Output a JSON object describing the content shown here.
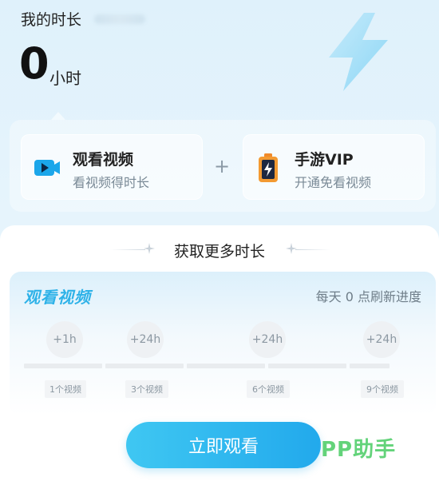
{
  "header": {
    "title": "我的时长",
    "hours_value": "0",
    "hours_unit": "小时"
  },
  "options": [
    {
      "title": "观看视频",
      "subtitle": "看视频得时长",
      "icon": "video-camera-icon"
    },
    {
      "title": "手游VIP",
      "subtitle": "开通免看视频",
      "icon": "battery-bolt-icon"
    }
  ],
  "plus_symbol": "+",
  "section": {
    "title": "获取更多时长"
  },
  "watch_card": {
    "label": "观看视频",
    "refresh_note": "每天 0 点刷新进度",
    "milestones": [
      {
        "reward": "+1h",
        "requirement": "1个视频"
      },
      {
        "reward": "+24h",
        "requirement": "3个视频"
      },
      {
        "reward": "+24h",
        "requirement": "6个视频"
      },
      {
        "reward": "+24h",
        "requirement": "9个视频"
      }
    ],
    "progress": 0
  },
  "cta": {
    "label": "立即观看"
  },
  "watermark": "PP助手",
  "colors": {
    "accent": "#22a9ec",
    "accent_light": "#3fc7f2",
    "label_blue": "#2eb2e8",
    "watermark_green": "#63d37a"
  }
}
